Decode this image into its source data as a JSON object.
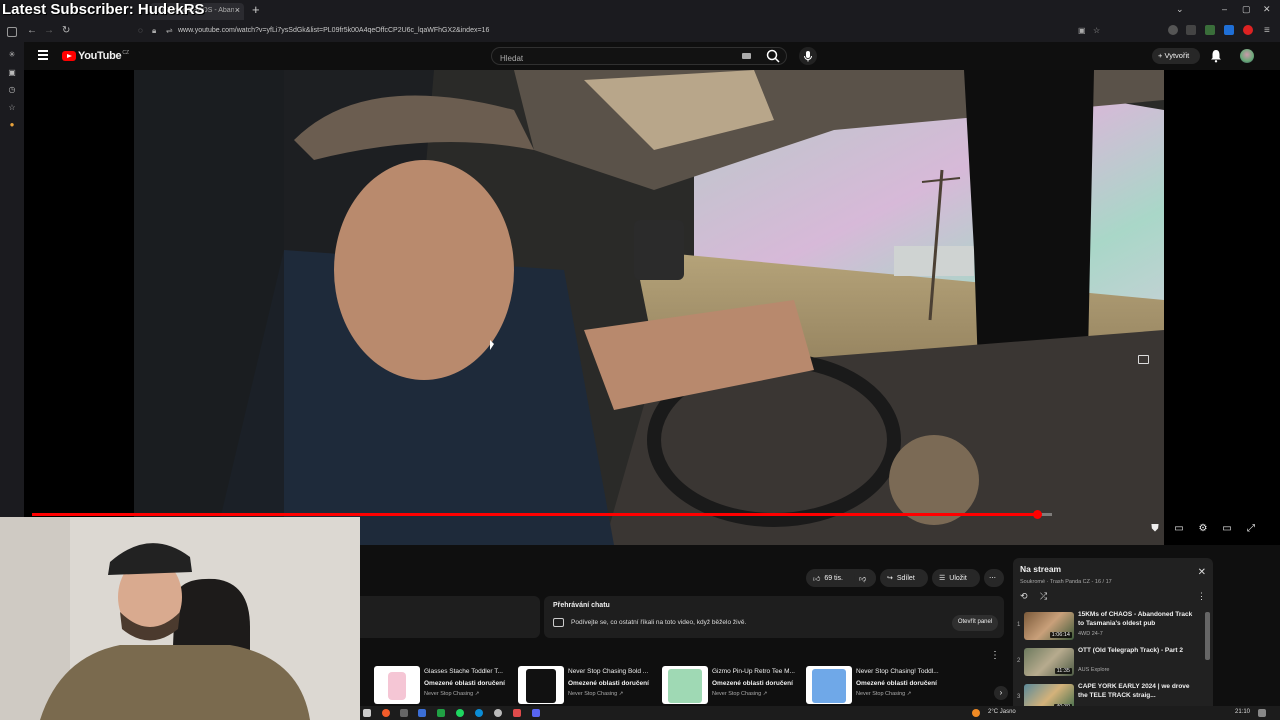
{
  "stream_overlay": {
    "latest_subscriber": "Latest Subscriber: HudekRS"
  },
  "browser": {
    "tab_label": "15KMs of CHAOS - Abandoned",
    "url": "www.youtube.com/watch?v=yfLi7ysSdGk&list=PL09fr5k00A4qeOffcCP2U6c_lqaWFhGX2&index=16"
  },
  "youtube": {
    "logo_text": "YouTube",
    "country_code": "CZ",
    "search_placeholder": "Hledat",
    "create_label": "Vytvořit"
  },
  "player": {
    "progress": 0.985
  },
  "actions": {
    "likes": "69 tis.",
    "share": "Sdílet",
    "save": "Uložit"
  },
  "chat": {
    "title": "Přehrávání chatu",
    "description": "Podívejte se, co ostatní říkali na toto video, když běželo živě.",
    "open_panel": "Otevřít panel"
  },
  "merch": [
    {
      "title": "Glasses Stache Toddler T...",
      "shipping": "Omezené oblasti doručení",
      "shop": "Never Stop Chasing ↗"
    },
    {
      "title": "Never Stop Chasing Bold ...",
      "shipping": "Omezené oblasti doručení",
      "shop": "Never Stop Chasing ↗"
    },
    {
      "title": "Gizmo Pin-Up Retro Tee M...",
      "shipping": "Omezené oblasti doručení",
      "shop": "Never Stop Chasing ↗"
    },
    {
      "title": "Never Stop Chasing! Toddl...",
      "shipping": "Omezené oblasti doručení",
      "shop": "Never Stop Chasing ↗"
    }
  ],
  "playlist": {
    "title": "Na stream",
    "subtitle": "Soukromé · Trash Panda CZ - 16 / 17",
    "items": [
      {
        "num": "1",
        "title": "15KMs of CHAOS - Abandoned Track to Tasmania's oldest pub",
        "channel": "4WD 24-7",
        "duration": "1:06:14"
      },
      {
        "num": "2",
        "title": "OTT (Old Telegraph Track) - Part 2",
        "channel": "AUS Explore",
        "duration": "11:35"
      },
      {
        "num": "3",
        "title": "CAPE YORK EARLY 2024 | we drove the TELE TRACK straig...",
        "channel": "",
        "duration": "40:30"
      }
    ]
  },
  "taskbar": {
    "weather": "2°C  Jasno",
    "time": "21:10"
  }
}
